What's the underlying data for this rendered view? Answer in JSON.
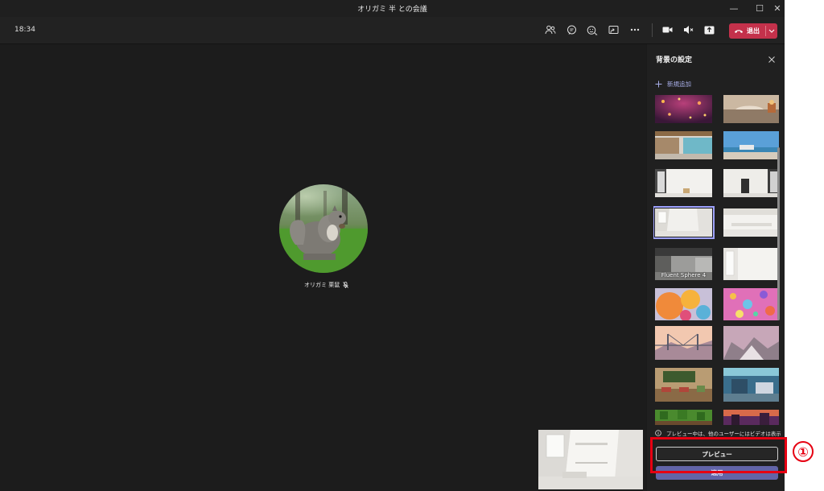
{
  "window": {
    "title": "オリガミ 半 との会議",
    "minimize_glyph": "—",
    "maximize_glyph": "☐",
    "close_glyph": "✕"
  },
  "toolbar": {
    "time": "18:34",
    "leave_label": "退出",
    "icons": [
      "participants-icon",
      "chat-icon",
      "reactions-icon",
      "share-tray-icon",
      "more-options-icon",
      "camera-icon",
      "mic-muted-icon",
      "share-screen-icon"
    ]
  },
  "stage": {
    "participant_name": "オリガミ 栗鼠"
  },
  "panel": {
    "title": "背景の設定",
    "add_new_label": "新規追加",
    "selected_label": "Fluent Sphere 4",
    "notice_text": "プレビュー中は、他のユーザーにはビデオは表示されませ",
    "preview_button": "プレビュー",
    "apply_button": "適用"
  },
  "annotation": {
    "marker": "①",
    "color": "#e60012"
  },
  "colors": {
    "accent": "#6264a7",
    "leave_red": "#c4314b",
    "link": "#a8aee8"
  }
}
